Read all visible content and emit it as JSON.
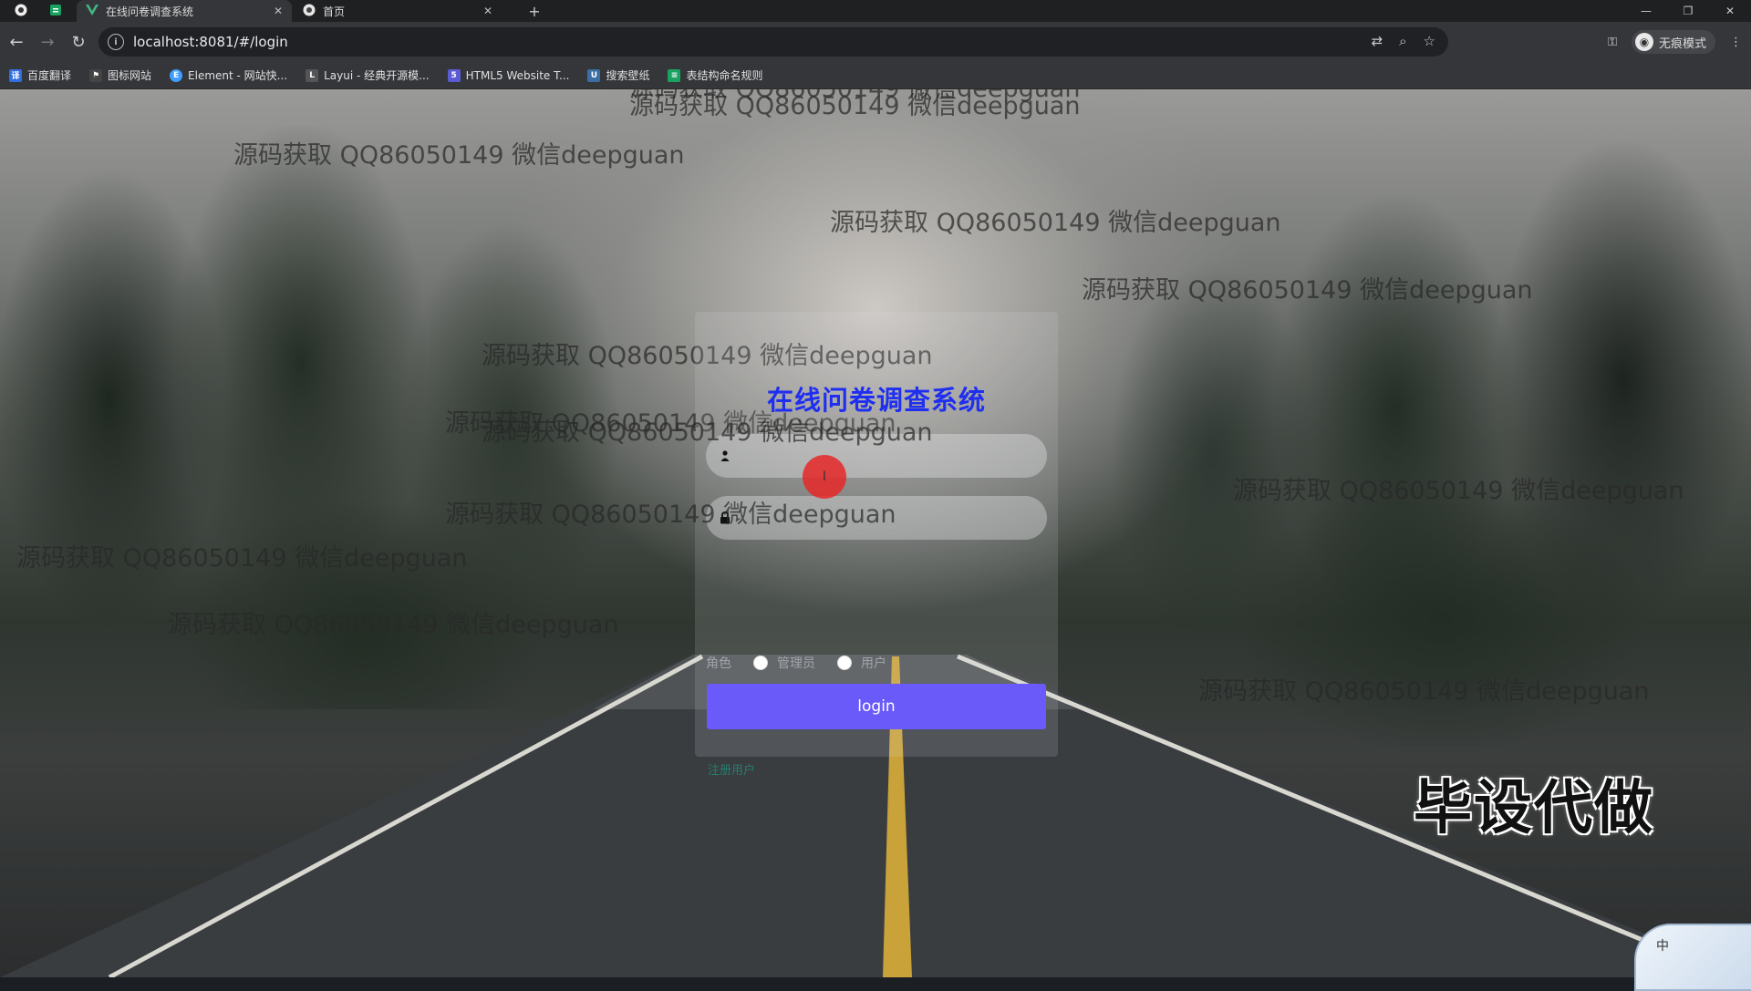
{
  "browser": {
    "tabs": [
      {
        "title": "",
        "icon": "chrome-icon",
        "pinned": true
      },
      {
        "title": "",
        "icon": "app-icon",
        "pinned": true
      },
      {
        "title": "在线问卷调查系统",
        "icon": "vue-icon",
        "active": true
      },
      {
        "title": "首页",
        "icon": "globe-icon"
      }
    ],
    "url": "localhost:8081/#/login",
    "profile_label": "无痕模式",
    "bookmarks": [
      {
        "label": "百度翻译",
        "icon": "translate-icon",
        "color": "#2f6fe0"
      },
      {
        "label": "图标网站",
        "icon": "flag-icon",
        "color": "#444444"
      },
      {
        "label": "Element - 网站快...",
        "icon": "element-icon",
        "color": "#409eff"
      },
      {
        "label": "Layui - 经典开源模...",
        "icon": "layui-icon",
        "color": "#555555"
      },
      {
        "label": "HTML5 Website T...",
        "icon": "html5-icon",
        "color": "#5b5bd6"
      },
      {
        "label": "搜索壁纸",
        "icon": "wallpaper-icon",
        "color": "#3a6ea5"
      },
      {
        "label": "表结构命名规则",
        "icon": "doc-icon",
        "color": "#1aa260"
      }
    ]
  },
  "login": {
    "title": "在线问卷调查系统",
    "username_value": "",
    "password_value": "",
    "role_label": "角色",
    "roles": [
      "管理员",
      "用户"
    ],
    "button_label": "login",
    "register_label": "注册用户",
    "title_color": "#1f2ff0",
    "button_color": "#6a5af9"
  },
  "watermark": {
    "text": "源码获取 QQ86050149 微信deepguan",
    "corner_text": "毕设代做"
  },
  "ime": {
    "label": "中"
  }
}
